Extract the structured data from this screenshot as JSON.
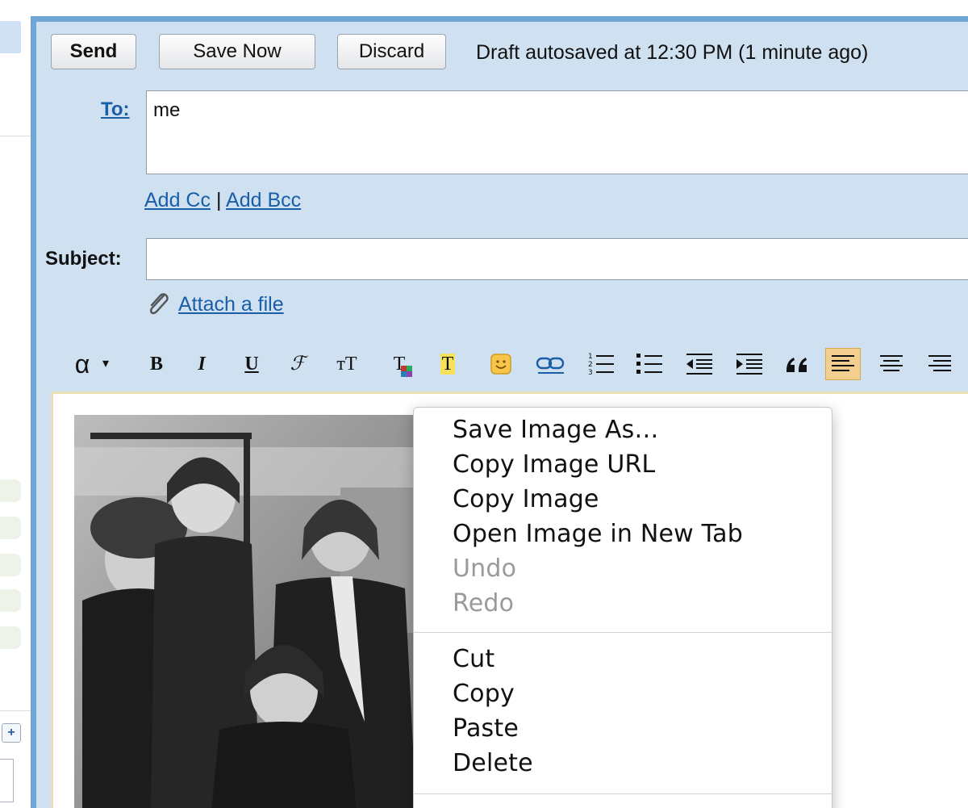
{
  "buttons": {
    "send": "Send",
    "save_now": "Save Now",
    "discard": "Discard"
  },
  "autosave_status": "Draft autosaved at 12:30 PM (1 minute ago)",
  "to": {
    "label": "To:",
    "value": "me"
  },
  "cc": {
    "add_cc": "Add Cc",
    "separator": "|",
    "add_bcc": "Add Bcc"
  },
  "subject": {
    "label": "Subject:",
    "value": ""
  },
  "attach": {
    "label": "Attach a file"
  },
  "toolbar": {
    "font_glyph": "α",
    "font_caret": "▾",
    "bold": "B",
    "italic": "I",
    "underline": "U",
    "font": "ℱ",
    "size": "тT",
    "text_color": "T",
    "highlight": "T"
  },
  "context_menu": {
    "items": [
      {
        "label": "Save Image As…",
        "enabled": true
      },
      {
        "label": "Copy Image URL",
        "enabled": true
      },
      {
        "label": "Copy Image",
        "enabled": true
      },
      {
        "label": "Open Image in New Tab",
        "enabled": true
      },
      {
        "label": "Undo",
        "enabled": false
      },
      {
        "label": "Redo",
        "enabled": false
      },
      {
        "label": "Cut",
        "enabled": true
      },
      {
        "label": "Copy",
        "enabled": true
      },
      {
        "label": "Paste",
        "enabled": true
      },
      {
        "label": "Delete",
        "enabled": true
      }
    ]
  },
  "colors": {
    "compose_bg": "#cfe1f1",
    "frame_border": "#6fa6d6",
    "link": "#1a5ea8",
    "active_tool": "#f2cf8e"
  }
}
